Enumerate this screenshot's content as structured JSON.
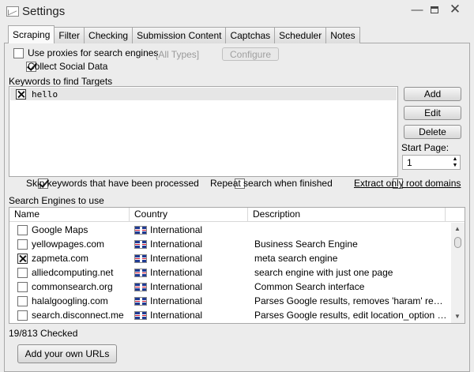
{
  "window": {
    "title": "Settings"
  },
  "tabs": [
    "Scraping",
    "Filter",
    "Checking",
    "Submission Content",
    "Captchas",
    "Scheduler",
    "Notes"
  ],
  "proxy": {
    "label": "Use proxies for search engines",
    "checked": false,
    "types": "[All Types]",
    "configure_label": "Configure"
  },
  "social": {
    "label": "Collect Social Data",
    "checked": true
  },
  "keywords": {
    "title": "Keywords to find Targets",
    "items": [
      {
        "text": "hello",
        "checked": true
      }
    ],
    "add_label": "Add",
    "edit_label": "Edit",
    "delete_label": "Delete",
    "start_page_label": "Start Page:",
    "start_page_value": "1"
  },
  "options": {
    "skip": {
      "label": "Skip keywords that have been processed",
      "checked": true
    },
    "repeat": {
      "label": "Repeat search when finished",
      "checked": false
    },
    "extract": {
      "label": "Extract only root domains",
      "checked": false
    }
  },
  "engines": {
    "title": "Search Engines to use",
    "columns": [
      "Name",
      "Country",
      "Description"
    ],
    "rows": [
      {
        "name": "Google Maps",
        "country": "International",
        "description": "",
        "checked": false
      },
      {
        "name": "yellowpages.com",
        "country": "International",
        "description": "Business Search Engine",
        "checked": false
      },
      {
        "name": "zapmeta.com",
        "country": "International",
        "description": "meta search engine",
        "checked": true
      },
      {
        "name": "alliedcomputing.net",
        "country": "International",
        "description": "search engine with just one page",
        "checked": false
      },
      {
        "name": "commonsearch.org",
        "country": "International",
        "description": "Common Search interface",
        "checked": false
      },
      {
        "name": "halalgoogling.com",
        "country": "International",
        "description": "Parses Google results, removes 'haram' results",
        "checked": false
      },
      {
        "name": "search.disconnect.me",
        "country": "International",
        "description": "Parses Google results, edit location_option to c...",
        "checked": false
      }
    ],
    "checked_count": "19/813 Checked"
  },
  "own_urls_label": "Add your own URLs",
  "icons": {
    "minimize": "minimize-icon",
    "maximize": "maximize-icon",
    "close": "close-icon"
  }
}
